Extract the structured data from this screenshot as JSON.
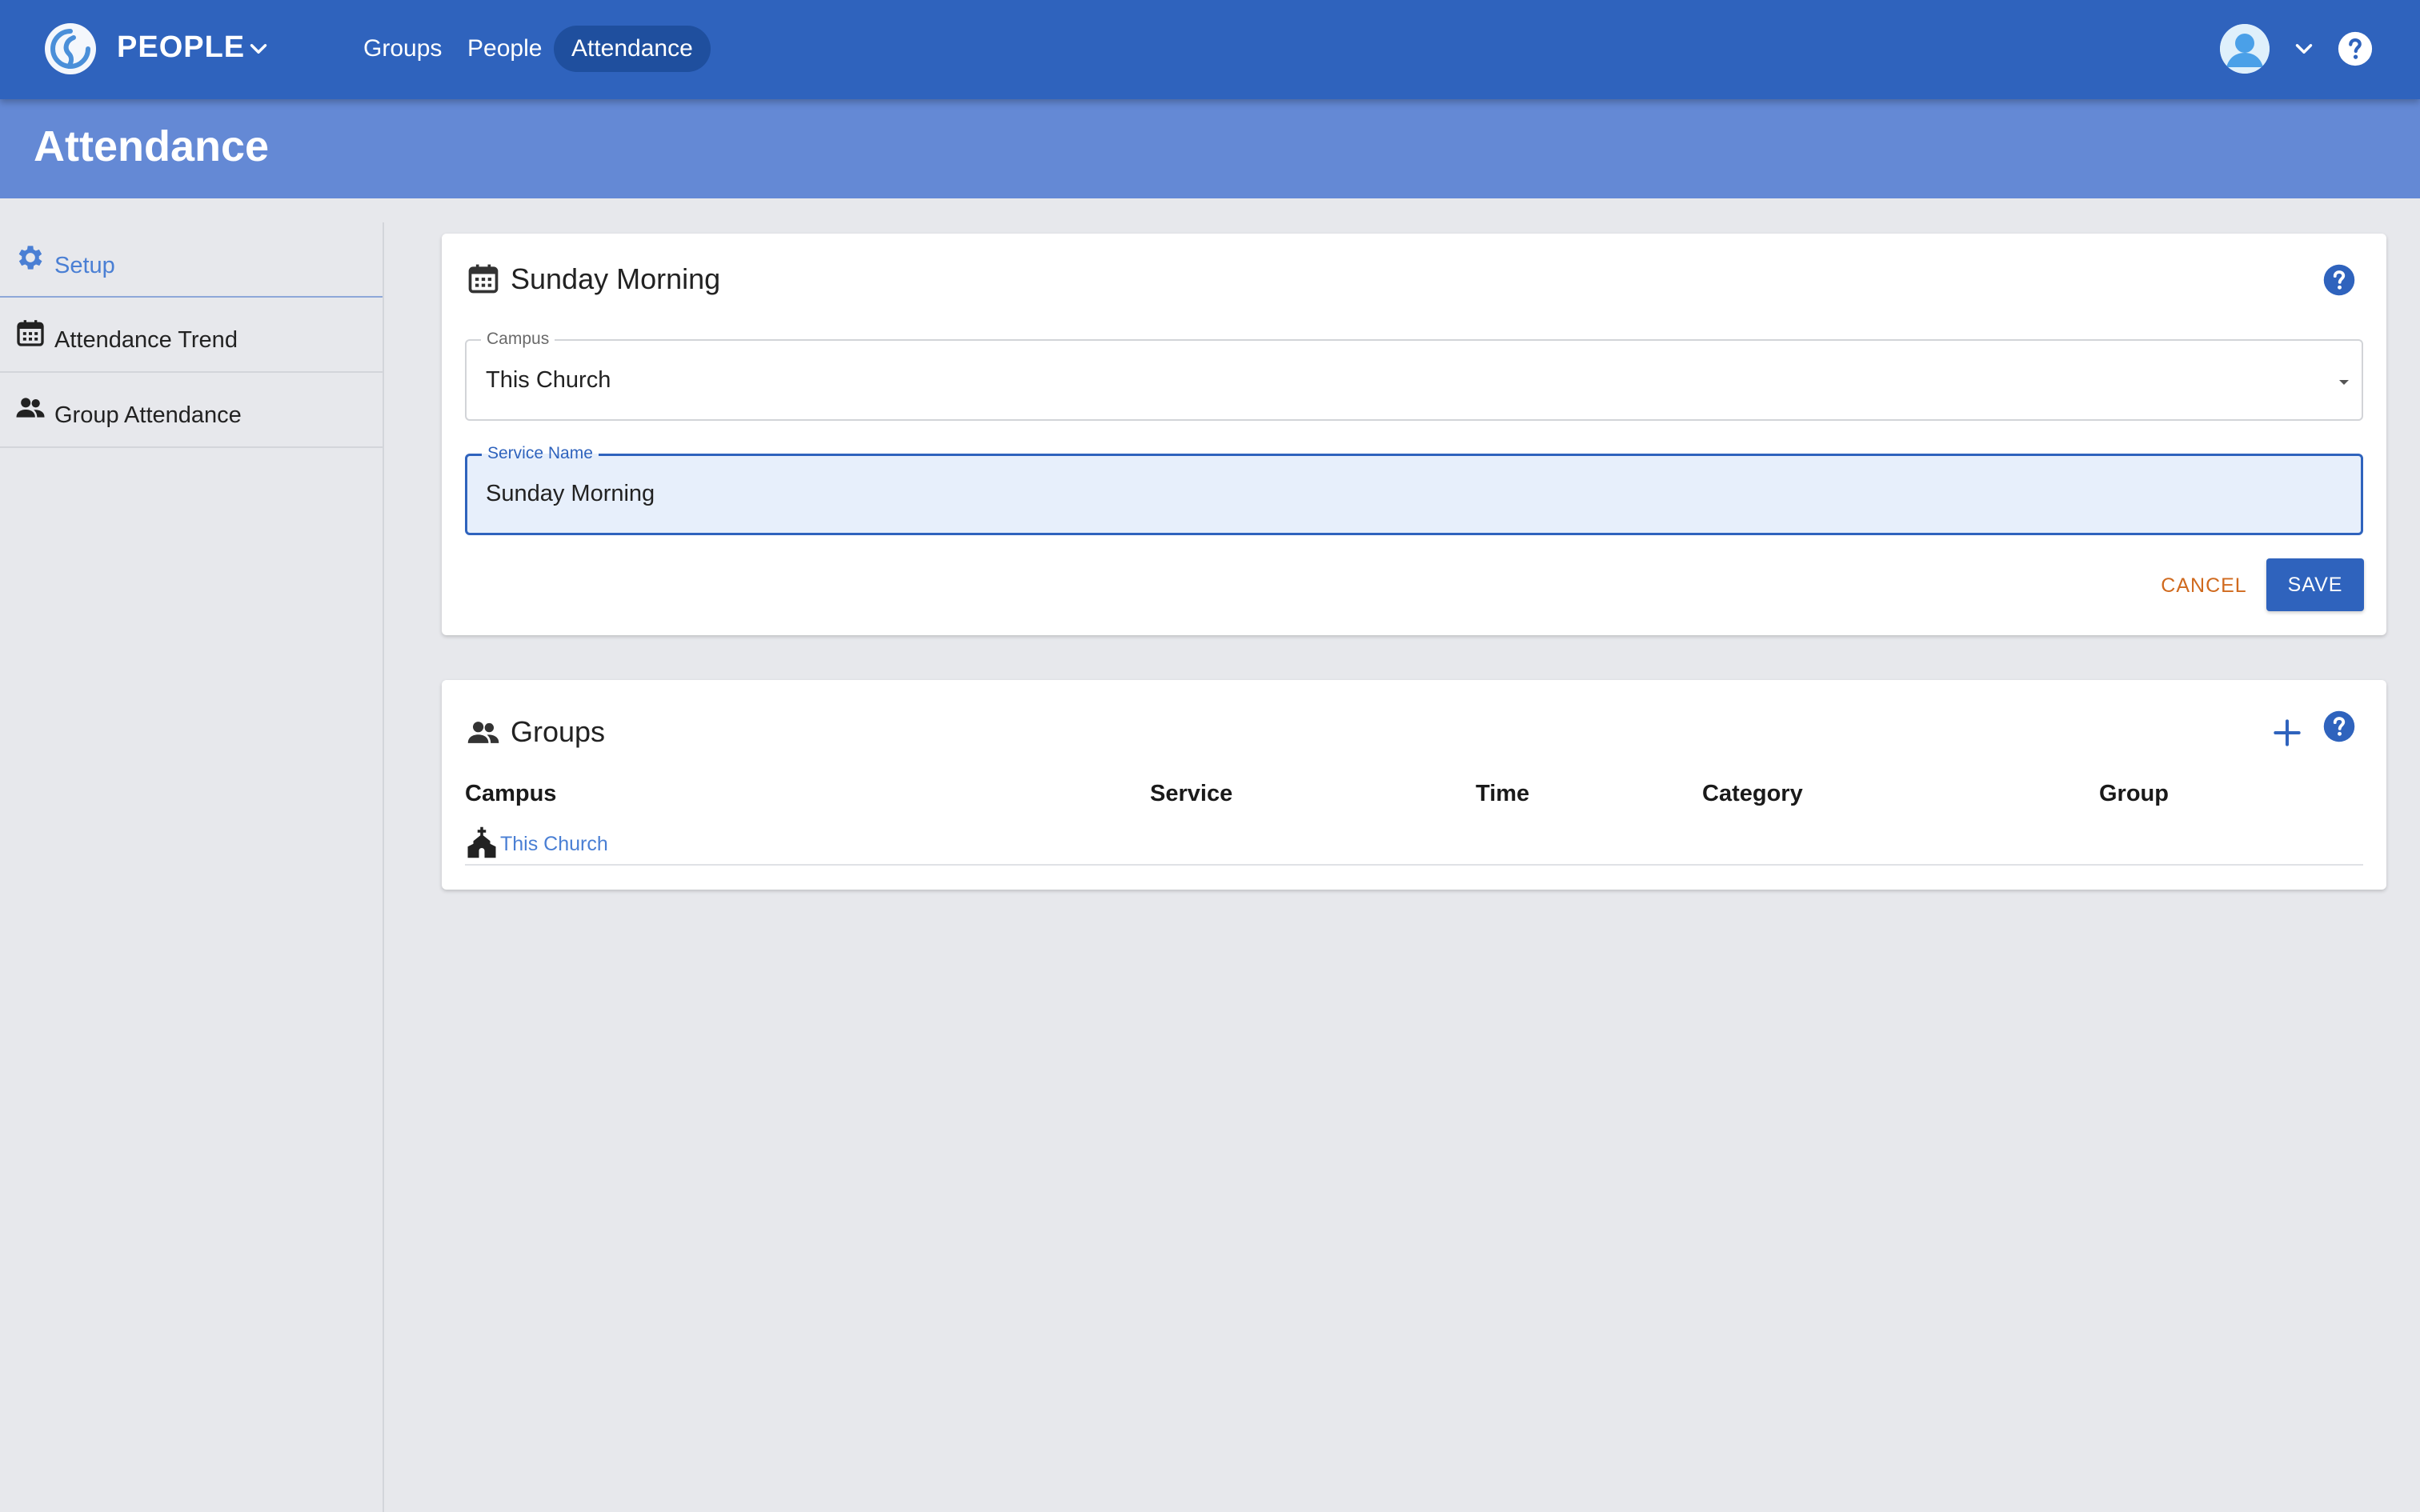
{
  "app": {
    "name": "PEOPLE",
    "brand_color": "#2f63bd",
    "title_band_color": "#6489d5",
    "logo_icon": "b1-logo-icon"
  },
  "nav": {
    "items": [
      {
        "label": "Groups",
        "active": false
      },
      {
        "label": "People",
        "active": false
      },
      {
        "label": "Attendance",
        "active": true
      }
    ]
  },
  "user": {
    "avatar_icon": "user-avatar-icon",
    "help_icon": "help-icon"
  },
  "page": {
    "title": "Attendance"
  },
  "sidebar": {
    "items": [
      {
        "label": "Setup",
        "icon": "gear-icon",
        "active": true
      },
      {
        "label": "Attendance Trend",
        "icon": "calendar-icon",
        "active": false
      },
      {
        "label": "Group Attendance",
        "icon": "people-icon",
        "active": false
      }
    ]
  },
  "service_card": {
    "title": "Sunday Morning",
    "icon": "calendar-icon",
    "campus_field": {
      "label": "Campus",
      "value": "This Church"
    },
    "service_field": {
      "label": "Service Name",
      "value": "Sunday Morning"
    },
    "cancel_label": "CANCEL",
    "save_label": "SAVE",
    "accent_cancel": "#d06a1e"
  },
  "groups_card": {
    "title": "Groups",
    "icon": "people-icon",
    "columns": [
      "Campus",
      "Service",
      "Time",
      "Category",
      "Group"
    ],
    "rows": [
      {
        "campus": "This Church",
        "icon": "church-icon"
      }
    ]
  }
}
